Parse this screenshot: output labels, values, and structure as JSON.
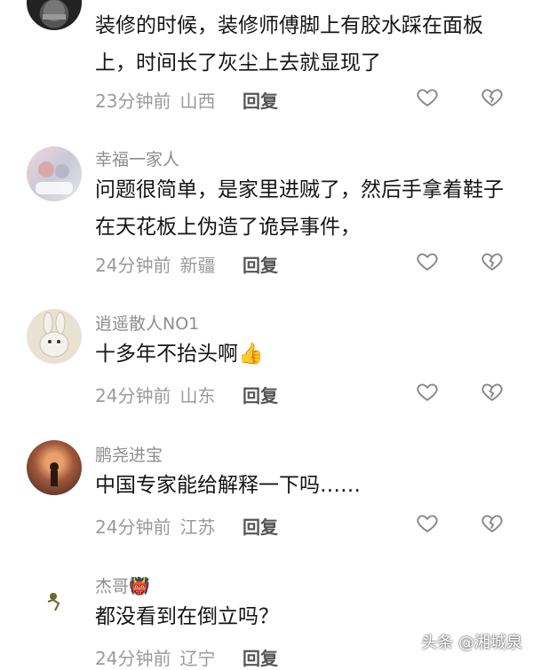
{
  "comments": [
    {
      "username": "",
      "text": "装修的时候，装修师傅脚上有胶水踩在面板上，时间长了灰尘上去就显现了",
      "time": "23分钟前",
      "location": "山西",
      "reply_label": "回复"
    },
    {
      "username": "幸福一家人",
      "text": "问题很简单，是家里进贼了，然后手拿着鞋子在天花板上伪造了诡异事件，",
      "time": "24分钟前",
      "location": "新疆",
      "reply_label": "回复"
    },
    {
      "username": "逍遥散人NO1",
      "text": "十多年不抬头啊👍",
      "time": "24分钟前",
      "location": "山东",
      "reply_label": "回复"
    },
    {
      "username": "鹏尧进宝",
      "text": "中国专家能给解释一下吗……",
      "time": "24分钟前",
      "location": "江苏",
      "reply_label": "回复"
    },
    {
      "username": "杰哥👹",
      "text": "都没看到在倒立吗？",
      "time": "24分钟前",
      "location": "辽宁",
      "reply_label": "回复"
    }
  ],
  "watermark": "头条 @湘城泉",
  "icons": {
    "like": "heart-icon",
    "dislike": "broken-heart-icon"
  }
}
